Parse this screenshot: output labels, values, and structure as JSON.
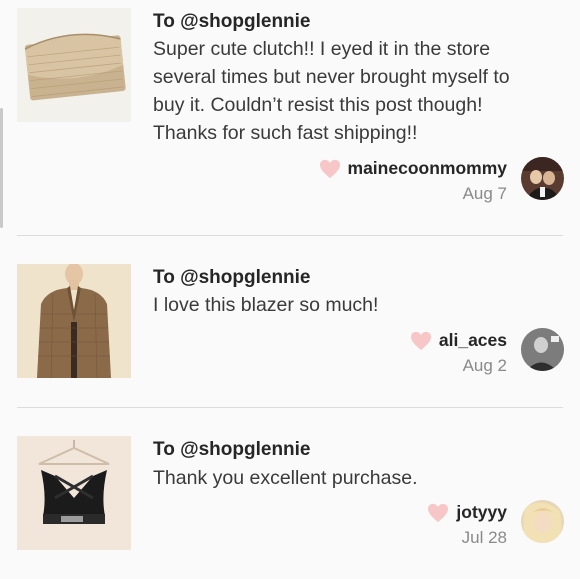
{
  "reviews": [
    {
      "to": "To @shopglennie",
      "lines": [
        "Super cute clutch!! I eyed it in the store",
        "several times but never brought myself to",
        "buy it. Couldn’t resist this post though!",
        "Thanks for such fast shipping!!"
      ],
      "username": "mainecoonmommy",
      "date": "Aug 7",
      "item_icon": "clutch-photo",
      "avatar_icon": "user-avatar-photo"
    },
    {
      "to": "To @shopglennie",
      "lines": [
        "I love this blazer so much!"
      ],
      "username": "ali_aces",
      "date": "Aug 2",
      "item_icon": "blazer-photo",
      "avatar_icon": "user-avatar-photo"
    },
    {
      "to": "To @shopglennie",
      "lines": [
        "Thank you excellent purchase."
      ],
      "username": "jotyyy",
      "date": "Jul 28",
      "item_icon": "sports-bra-photo",
      "avatar_icon": "user-avatar-photo"
    }
  ],
  "colors": {
    "heart": "#f7c6c6",
    "divider": "#dcdcdc",
    "muted_text": "#8a8a8a"
  }
}
